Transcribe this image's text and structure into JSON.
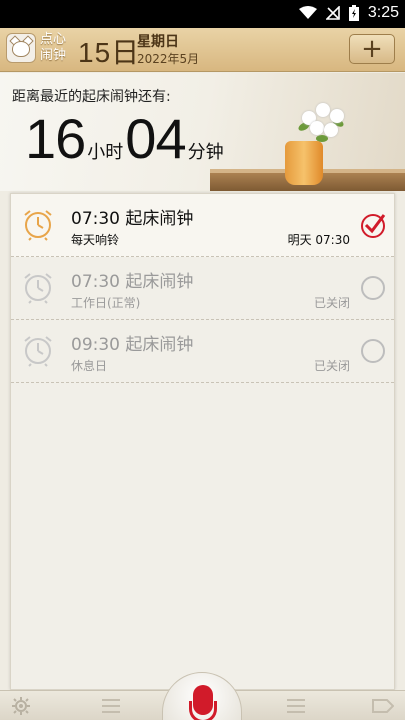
{
  "status_bar": {
    "time": "3:25",
    "icons": [
      "wifi-icon",
      "signal-off-icon",
      "battery-charging-icon"
    ]
  },
  "header": {
    "app_name": "点心闹钟",
    "day": "15日",
    "weekday": "星期日",
    "month": "2022年5月",
    "add_label": "+"
  },
  "hero": {
    "label": "距离最近的起床闹钟还有:",
    "hours": "16",
    "hours_unit": "小时",
    "minutes": "04",
    "minutes_unit": "分钟"
  },
  "alarms": [
    {
      "time_title": "07:30 起床闹钟",
      "repeat": "每天响铃",
      "status": "明天 07:30",
      "enabled": true
    },
    {
      "time_title": "07:30 起床闹钟",
      "repeat": "工作日(正常)",
      "status": "已关闭",
      "enabled": false
    },
    {
      "time_title": "09:30 起床闹钟",
      "repeat": "休息日",
      "status": "已关闭",
      "enabled": false
    }
  ],
  "bottom_bar": {
    "icons": [
      "settings-icon",
      "list-icon",
      "mic-icon",
      "list-icon",
      "tag-icon"
    ]
  },
  "colors": {
    "accent_red": "#d11b2a",
    "header_gold": "#d8b780",
    "clock_orange": "#e8a54a"
  }
}
